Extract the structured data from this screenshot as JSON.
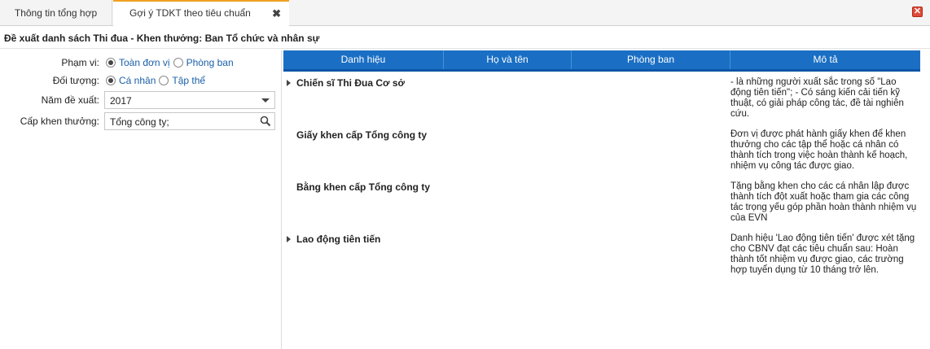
{
  "tabs": [
    {
      "label": "Thông tin tổng hợp"
    },
    {
      "label": "Gợi ý TDKT theo tiêu chuẩn",
      "close": "✖"
    }
  ],
  "window_close": "✕",
  "page_title": "Đề xuất danh sách Thi đua - Khen thưởng: Ban Tổ chức và nhân sự",
  "form": {
    "scope": {
      "label": "Phạm vi:",
      "options": [
        "Toàn đơn vị",
        "Phòng ban"
      ],
      "selected": "Toàn đơn vị"
    },
    "target": {
      "label": "Đối tượng:",
      "options": [
        "Cá nhân",
        "Tập thể"
      ],
      "selected": "Cá nhân"
    },
    "year": {
      "label": "Năm đề xuất:",
      "value": "2017"
    },
    "level": {
      "label": "Cấp khen thưởng:",
      "value": "Tổng công ty;"
    }
  },
  "grid": {
    "columns": [
      "Danh hiệu",
      "Họ và tên",
      "Phòng ban",
      "Mô tả"
    ],
    "rows": [
      {
        "title": "Chiến sĩ Thi Đua Cơ sở",
        "expandable": true,
        "description": "- là những người xuất sắc trong số \"Lao động tiên tiến\"; - Có sáng kiến cải tiến kỹ thuật, có giải pháp công tác, đề tài nghiên cứu."
      },
      {
        "title": "Giấy khen cấp Tổng công ty",
        "expandable": false,
        "description": "Đơn vị được phát hành giấy khen để khen thưởng cho các tập thể hoặc cá nhân có thành tích trong việc hoàn thành kế hoạch, nhiệm vụ công tác được giao."
      },
      {
        "title": "Bằng khen cấp Tổng công ty",
        "expandable": false,
        "description": "Tặng bằng khen cho các cá nhân lập được thành tích đột xuất hoặc tham gia các công tác trọng yếu góp phần hoàn thành nhiệm vụ của EVN"
      },
      {
        "title": "Lao động tiên tiến",
        "expandable": true,
        "description": "Danh hiệu 'Lao động tiên tiến' được xét tặng cho CBNV đạt các tiêu chuẩn sau: Hoàn thành tốt nhiệm vụ được giao, các trường hợp tuyển dụng từ 10 tháng trở lên."
      }
    ]
  }
}
